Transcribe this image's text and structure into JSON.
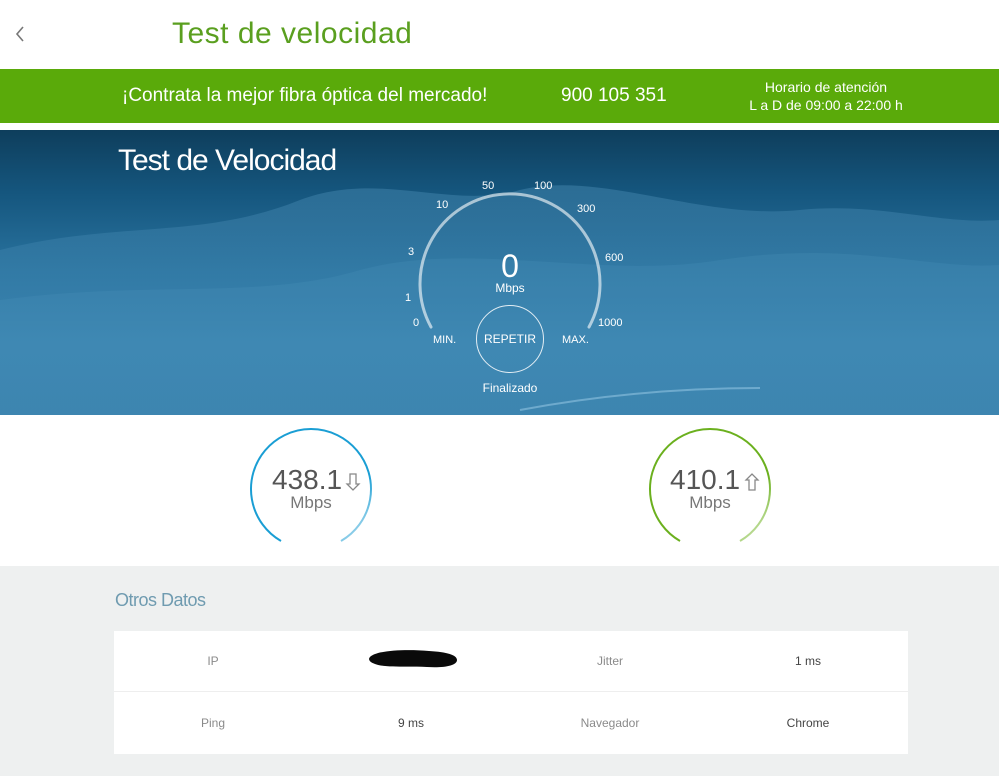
{
  "header": {
    "title": "Test de velocidad"
  },
  "promo": {
    "text": "¡Contrata la mejor fibra óptica del mercado!",
    "phone": "900 105 351",
    "hours_title": "Horario de atención",
    "hours_detail": "L a D de 09:00 a 22:00 h"
  },
  "hero": {
    "title": "Test de Velocidad",
    "gauge": {
      "value": "0",
      "unit": "Mbps",
      "scale": [
        "0",
        "1",
        "3",
        "10",
        "50",
        "100",
        "300",
        "600",
        "1000"
      ],
      "min_label": "MIN.",
      "max_label": "MAX."
    },
    "repeat_label": "REPETIR",
    "status": "Finalizado"
  },
  "results": {
    "download": {
      "value": "438.1",
      "unit": "Mbps",
      "arrow": "download-arrow-icon",
      "color": "#1a9ed4"
    },
    "upload": {
      "value": "410.1",
      "unit": "Mbps",
      "arrow": "upload-arrow-icon",
      "color": "#6bb01e"
    }
  },
  "other": {
    "title": "Otros Datos",
    "rows": [
      {
        "label1": "IP",
        "value1": "",
        "label2": "Jitter",
        "value2": "1 ms"
      },
      {
        "label1": "Ping",
        "value1": "9 ms",
        "label2": "Navegador",
        "value2": "Chrome"
      }
    ]
  },
  "colors": {
    "brand_green": "#5aaa0a",
    "title_green": "#5a9f1f",
    "hero_blue": "#15567e"
  }
}
